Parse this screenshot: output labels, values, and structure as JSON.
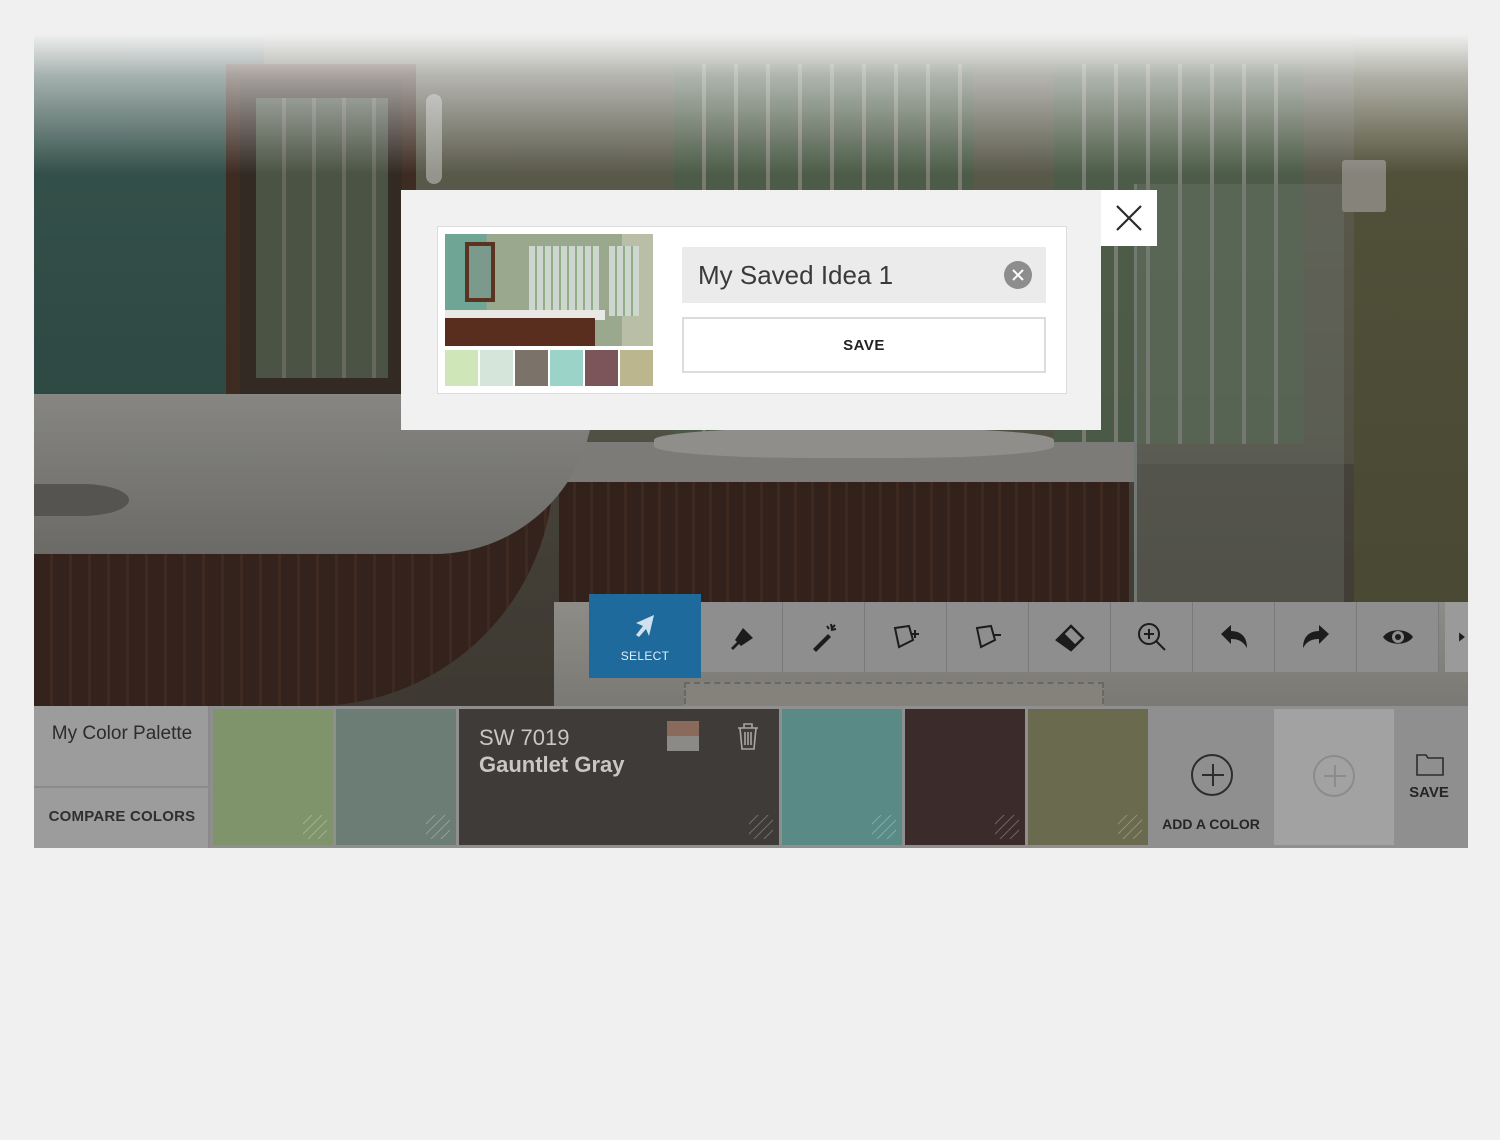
{
  "toolbar": {
    "select_label": "SELECT",
    "tools": [
      "select-icon",
      "paint-bucket-icon",
      "magic-wand-icon",
      "add-shape-icon",
      "remove-shape-icon",
      "eraser-icon",
      "zoom-in-icon",
      "undo-icon",
      "redo-icon",
      "eye-icon",
      "chevron-right-icon"
    ]
  },
  "dialog": {
    "name_value": "My Saved Idea 1",
    "save_label": "SAVE",
    "chip_colors": [
      "#cfe6b8",
      "#d5e5da",
      "#7b7369",
      "#9cd3c8",
      "#7b5559",
      "#bcb68e"
    ]
  },
  "palette": {
    "title": "My Color Palette",
    "compare_label": "COMPARE COLORS",
    "swatch_colors": [
      "#7f946a",
      "#6c7d75",
      "#3f3b38",
      "#5a8a85",
      "#3c2b2b",
      "#6a6a4e"
    ],
    "selected": {
      "code": "SW 7019",
      "name": "Gauntlet Gray"
    },
    "add_label": "ADD A COLOR",
    "save_label": "SAVE"
  },
  "colors": {
    "accent": "#1f6a9c"
  }
}
